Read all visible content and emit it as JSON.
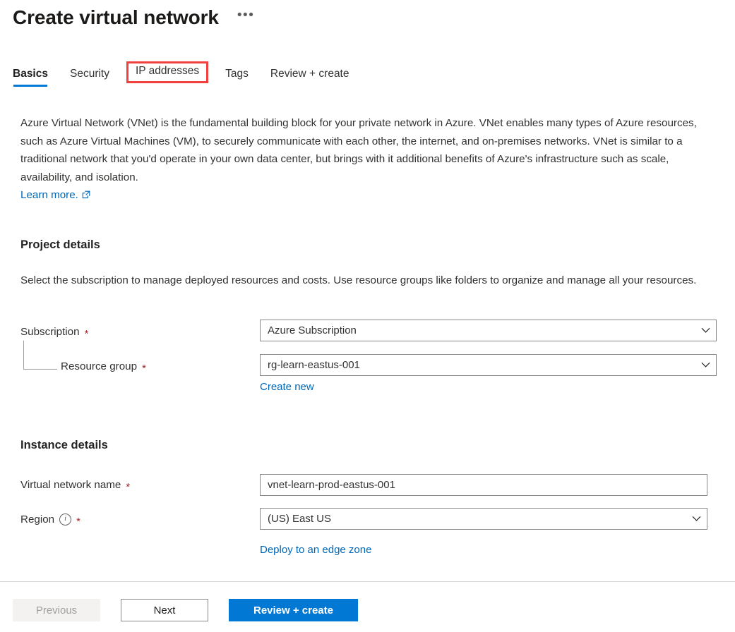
{
  "header": {
    "title": "Create virtual network",
    "more_menu": "•••"
  },
  "tabs": [
    {
      "label": "Basics",
      "selected": true,
      "highlighted": false
    },
    {
      "label": "Security",
      "selected": false,
      "highlighted": false
    },
    {
      "label": "IP addresses",
      "selected": false,
      "highlighted": true
    },
    {
      "label": "Tags",
      "selected": false,
      "highlighted": false
    },
    {
      "label": "Review + create",
      "selected": false,
      "highlighted": false
    }
  ],
  "intro": {
    "paragraph": "Azure Virtual Network (VNet) is the fundamental building block for your private network in Azure. VNet enables many types of Azure resources, such as Azure Virtual Machines (VM), to securely communicate with each other, the internet, and on-premises networks. VNet is similar to a traditional network that you'd operate in your own data center, but brings with it additional benefits of Azure's infrastructure such as scale, availability, and isolation.",
    "learn_more": "Learn more."
  },
  "project_details": {
    "heading": "Project details",
    "description": "Select the subscription to manage deployed resources and costs. Use resource groups like folders to organize and manage all your resources.",
    "subscription": {
      "label": "Subscription",
      "required": "*",
      "value": "Azure Subscription"
    },
    "resource_group": {
      "label": "Resource group",
      "required": "*",
      "value": "rg-learn-eastus-001",
      "create_new": "Create new"
    }
  },
  "instance_details": {
    "heading": "Instance details",
    "virtual_network_name": {
      "label": "Virtual network name",
      "required": "*",
      "value": "vnet-learn-prod-eastus-001"
    },
    "region": {
      "label": "Region",
      "required": "*",
      "value": "(US) East US",
      "edge_zone_link": "Deploy to an edge zone"
    }
  },
  "footer": {
    "previous": "Previous",
    "next": "Next",
    "review_create": "Review + create"
  },
  "colors": {
    "accent": "#0078d4",
    "link": "#0067b8",
    "highlight_box": "#f04040",
    "required_asterisk": "#a4262c",
    "border": "#8a8886"
  }
}
